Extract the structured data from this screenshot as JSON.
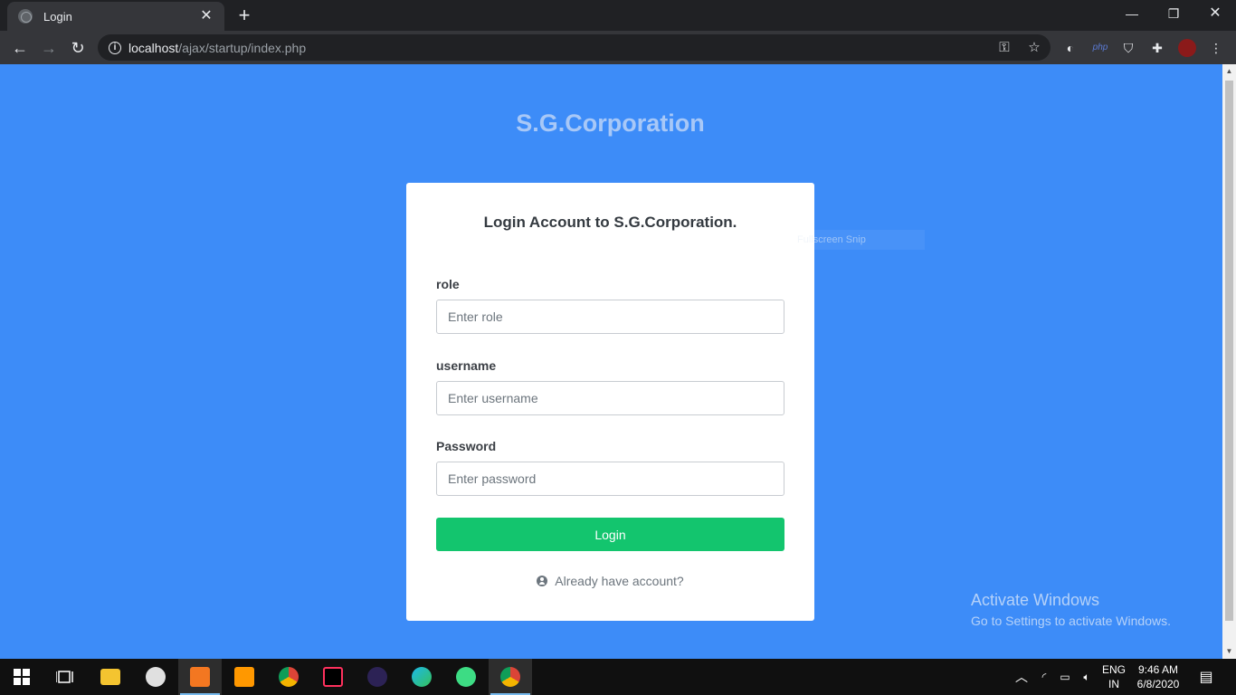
{
  "browser": {
    "tab_title": "Login",
    "url_host": "localhost",
    "url_path": "/ajax/startup/index.php"
  },
  "page": {
    "brand": "S.G.Corporation",
    "card_title": "Login Account to S.G.Corporation.",
    "snip_overlay": "Fullscreen Snip",
    "fields": [
      {
        "label": "role",
        "placeholder": "Enter role"
      },
      {
        "label": "username",
        "placeholder": "Enter username"
      },
      {
        "label": "Password",
        "placeholder": "Enter password"
      }
    ],
    "login_button": "Login",
    "already_link": "Already have account?",
    "colors": {
      "background": "#3d8cf8",
      "button": "#13c56e",
      "brand": "#a8c8f7"
    }
  },
  "watermark": {
    "title": "Activate Windows",
    "subtitle": "Go to Settings to activate Windows."
  },
  "taskbar": {
    "lang_top": "ENG",
    "lang_bottom": "IN",
    "time": "9:46 AM",
    "date": "6/8/2020"
  }
}
